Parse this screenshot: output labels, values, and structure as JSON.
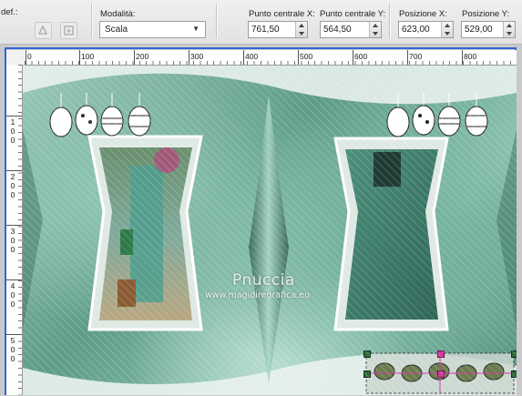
{
  "toolbar": {
    "preset_label": "def.:",
    "mode_label": "Modalità:",
    "mode_value": "Scala",
    "center_x_label": "Punto centrale X:",
    "center_x_value": "761,50",
    "center_y_label": "Punto centrale Y:",
    "center_y_value": "564,50",
    "pos_x_label": "Posizione X:",
    "pos_x_value": "623,00",
    "pos_y_label": "Posizione Y:",
    "pos_y_value": "529,00"
  },
  "ruler": {
    "top_labels": [
      "0",
      "100",
      "200",
      "300",
      "400",
      "500",
      "600",
      "700",
      "800"
    ],
    "left_labels": [
      "1\n0\n0",
      "2\n0\n0",
      "3\n0\n0",
      "4\n0\n0",
      "5\n0\n0"
    ]
  },
  "canvas": {
    "watermark_name": "Pnuccia",
    "watermark_url": "www.magidiregrafica.eu"
  },
  "colors": {
    "accent_blue": "#2f66d8",
    "teal_bg": "#5e9c88",
    "handle_green": "#2d6b3a",
    "handle_pink": "#d23aa0"
  }
}
